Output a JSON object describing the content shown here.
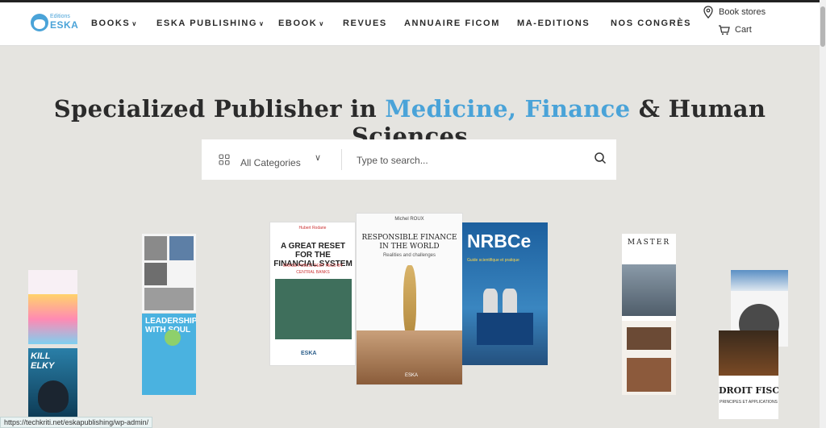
{
  "brand": {
    "small": "Editions",
    "big": "ESKA"
  },
  "nav": [
    {
      "label": "BOOKS",
      "dropdown": true
    },
    {
      "label": "ESKA PUBLISHING",
      "dropdown": true
    },
    {
      "label": "EBOOK",
      "dropdown": true
    },
    {
      "label": "REVUES",
      "dropdown": false
    },
    {
      "label": "ANNUAIRE FICOM",
      "dropdown": false
    },
    {
      "label": "MA-EDITIONS",
      "dropdown": false
    },
    {
      "label": "NOS CONGRÈS",
      "dropdown": false
    }
  ],
  "header_links": {
    "stores": "Book stores",
    "cart": "Cart"
  },
  "hero": {
    "part1": "Specialized Publisher in ",
    "accent": "Medicine, Finance",
    "part2": " & Human Sciences"
  },
  "search": {
    "category": "All Categories",
    "placeholder": "Type to search..."
  },
  "books": {
    "reset": {
      "author": "Hubert Rodarie",
      "title": "A GREAT RESET FOR THE FINANCIAL SYSTEM",
      "subtitle": "ERASE PUBLIC DEBT HELD BY CENTRAL BANKS",
      "publisher": "ESKA"
    },
    "responsible": {
      "author": "Michel ROUX",
      "title": "RESPONSIBLE FINANCE IN THE WORLD",
      "subtitle": "Realities and challenges",
      "publisher": "ESKA"
    },
    "nrbc": {
      "title": "NRBCe",
      "subtitle": "Guide scientifique et pratique"
    },
    "soul": {
      "title": "LEADERSHIP WITH SOUL"
    },
    "master": {
      "title": "MASTER"
    },
    "kill": {
      "title": "KILL ELKY"
    },
    "fiscal": {
      "title": "DROIT FISCAL",
      "subtitle": "PRINCIPES ET APPLICATIONS"
    }
  },
  "status_url": "https://techkriti.net/eskapublishing/wp-admin/",
  "colors": {
    "accent": "#4aa3d8",
    "background": "#e5e4e0",
    "text": "#2b2b2b"
  }
}
